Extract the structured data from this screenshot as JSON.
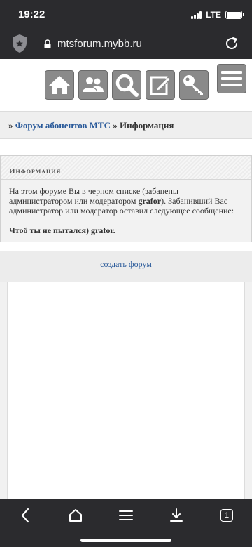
{
  "status_bar": {
    "time": "19:22",
    "network": "LTE",
    "battery_level": 1.0
  },
  "browser": {
    "url": "mtsforum.mybb.ru",
    "icons": [
      "shield-icon",
      "lock-icon",
      "reload-icon"
    ]
  },
  "forum_nav": {
    "buttons": [
      "home-icon",
      "users-icon",
      "search-icon",
      "edit-icon",
      "key-icon"
    ],
    "menu": "hamburger-icon"
  },
  "breadcrumb": {
    "separator1": "»",
    "forum_link": "Форум абонентов МТС",
    "separator2": "»",
    "current": "Информация"
  },
  "info": {
    "title": "Информация",
    "message_part1": "На этом форуме Вы в черном списке (забанены администратором или модератором ",
    "moderator": "grafor",
    "message_part2": "). Забанивший Вас администратор или модератор оставил следующее сообщение:",
    "ban_message": "Чтоб ты не пытался) grafor."
  },
  "footer": {
    "create_forum": "создать форум"
  },
  "toolbar": {
    "icons": [
      "back-icon",
      "home-icon",
      "menu-icon",
      "download-icon",
      "tabs-icon"
    ],
    "tab_count": "1"
  },
  "colors": {
    "chrome": "#2b2b2e",
    "link": "#2a5a9a",
    "icon_button": "#8a8a8a"
  }
}
